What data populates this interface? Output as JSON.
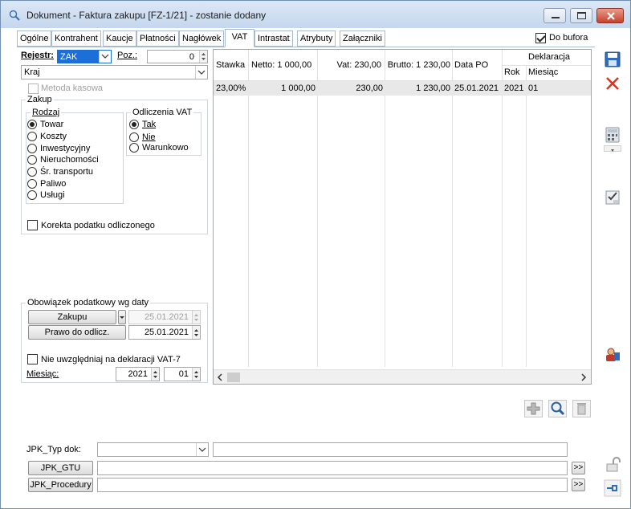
{
  "window": {
    "title": "Dokument - Faktura zakupu [FZ-1/21]  - zostanie dodany"
  },
  "tabs": [
    {
      "label": "Ogólne"
    },
    {
      "label": "Kontrahent"
    },
    {
      "label": "Kaucje"
    },
    {
      "label": "Płatności"
    },
    {
      "label": "Nagłówek"
    },
    {
      "label": "VAT"
    },
    {
      "label": "Intrastat"
    },
    {
      "label": "Atrybuty"
    },
    {
      "label": "Załączniki"
    }
  ],
  "do_bufora": {
    "label": "Do bufora",
    "checked": true
  },
  "left": {
    "rejestr_label": "Rejestr:",
    "rejestr_value": "ZAK",
    "poz_label": "Poz.:",
    "poz_value": "0",
    "kraj_value": "Kraj",
    "metoda_kasowa": "Metoda kasowa",
    "zakup_title": "Zakup",
    "rodzaj_title": "Rodzaj",
    "rodzaj_options": [
      "Towar",
      "Koszty",
      "Inwestycyjny",
      "Nieruchomości",
      "Śr. transportu",
      "Paliwo",
      "Usługi"
    ],
    "odliczenia_title": "Odliczenia VAT",
    "odliczenia_options": [
      "Tak",
      "Nie",
      "Warunkowo"
    ],
    "korekta": "Korekta podatku odliczonego",
    "obowiazek_title": "Obowiązek podatkowy wg daty",
    "zakupu_button": "Zakupu",
    "zakupu_date": "25.01.2021",
    "prawo_button": "Prawo do odlicz.",
    "prawo_date": "25.01.2021",
    "nie_uwzgledniaj": "Nie uwzględniaj na deklaracji VAT-7",
    "miesiac_label": "Miesiąc:",
    "miesiac_year": "2021",
    "miesiac_month": "01"
  },
  "grid": {
    "headers": {
      "stawka": "Stawka",
      "netto": "Netto: 1 000,00",
      "vat": "Vat: 230,00",
      "brutto": "Brutto: 1 230,00",
      "data_po": "Data PO",
      "deklaracja": "Deklaracja",
      "rok": "Rok",
      "miesiac": "Miesiąc"
    },
    "rows": [
      {
        "stawka": "23,00%",
        "netto": "1 000,00",
        "vat": "230,00",
        "brutto": "1 230,00",
        "data_po": "25.01.2021",
        "rok": "2021",
        "miesiac": "01"
      }
    ]
  },
  "jpk": {
    "typ_label": "JPK_Typ dok:",
    "gtu_button": "JPK_GTU",
    "procedury_button": "JPK_Procedury",
    "more": ">>"
  },
  "colors": {
    "accent": "#1c6fd8",
    "selection": "#e8e8e8",
    "grid_border": "#a6a6a6"
  }
}
